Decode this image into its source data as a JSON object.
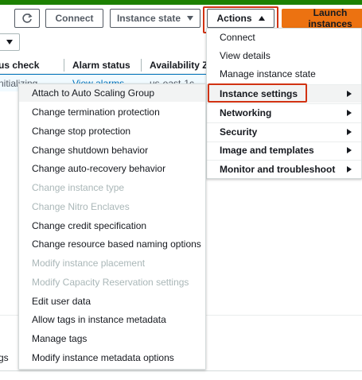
{
  "toolbar": {
    "connect_label": "Connect",
    "instance_state_label": "Instance state",
    "actions_label": "Actions",
    "launch_label": "Launch instances"
  },
  "table": {
    "headers": [
      "us check",
      "Alarm status",
      "Availability Zo"
    ],
    "row": {
      "status_check": "nitializing",
      "alarm_status": "View alarms",
      "availability_zone": "us-east-1c"
    }
  },
  "actions_menu": {
    "items": [
      {
        "label": "Connect",
        "type": "item"
      },
      {
        "label": "View details",
        "type": "item"
      },
      {
        "label": "Manage instance state",
        "type": "item"
      },
      {
        "label": "Instance settings",
        "type": "group",
        "active": true
      },
      {
        "label": "Networking",
        "type": "group"
      },
      {
        "label": "Security",
        "type": "group"
      },
      {
        "label": "Image and templates",
        "type": "group"
      },
      {
        "label": "Monitor and troubleshoot",
        "type": "group"
      }
    ]
  },
  "instance_settings_menu": {
    "items": [
      {
        "label": "Attach to Auto Scaling Group",
        "disabled": false
      },
      {
        "label": "Change termination protection",
        "disabled": false
      },
      {
        "label": "Change stop protection",
        "disabled": false
      },
      {
        "label": "Change shutdown behavior",
        "disabled": false
      },
      {
        "label": "Change auto-recovery behavior",
        "disabled": false
      },
      {
        "label": "Change instance type",
        "disabled": true
      },
      {
        "label": "Change Nitro Enclaves",
        "disabled": true
      },
      {
        "label": "Change credit specification",
        "disabled": false
      },
      {
        "label": "Change resource based naming options",
        "disabled": false
      },
      {
        "label": "Modify instance placement",
        "disabled": true
      },
      {
        "label": "Modify Capacity Reservation settings",
        "disabled": true
      },
      {
        "label": "Edit user data",
        "disabled": false
      },
      {
        "label": "Allow tags in instance metadata",
        "disabled": false
      },
      {
        "label": "Manage tags",
        "disabled": false
      },
      {
        "label": "Modify instance metadata options",
        "disabled": false
      }
    ]
  },
  "bottom_panel": {
    "partial_text": "gs"
  },
  "colors": {
    "accent": "#ec7211",
    "highlight": "#d13212",
    "link": "#0073bb",
    "top_bar": "#1d8102",
    "disabled": "#aab7b8"
  },
  "icons": {
    "refresh": "refresh-icon",
    "state_caret": "chevron-down-icon",
    "actions_caret": "caret-up-icon",
    "submenu_arrow": "chevron-right-icon"
  }
}
